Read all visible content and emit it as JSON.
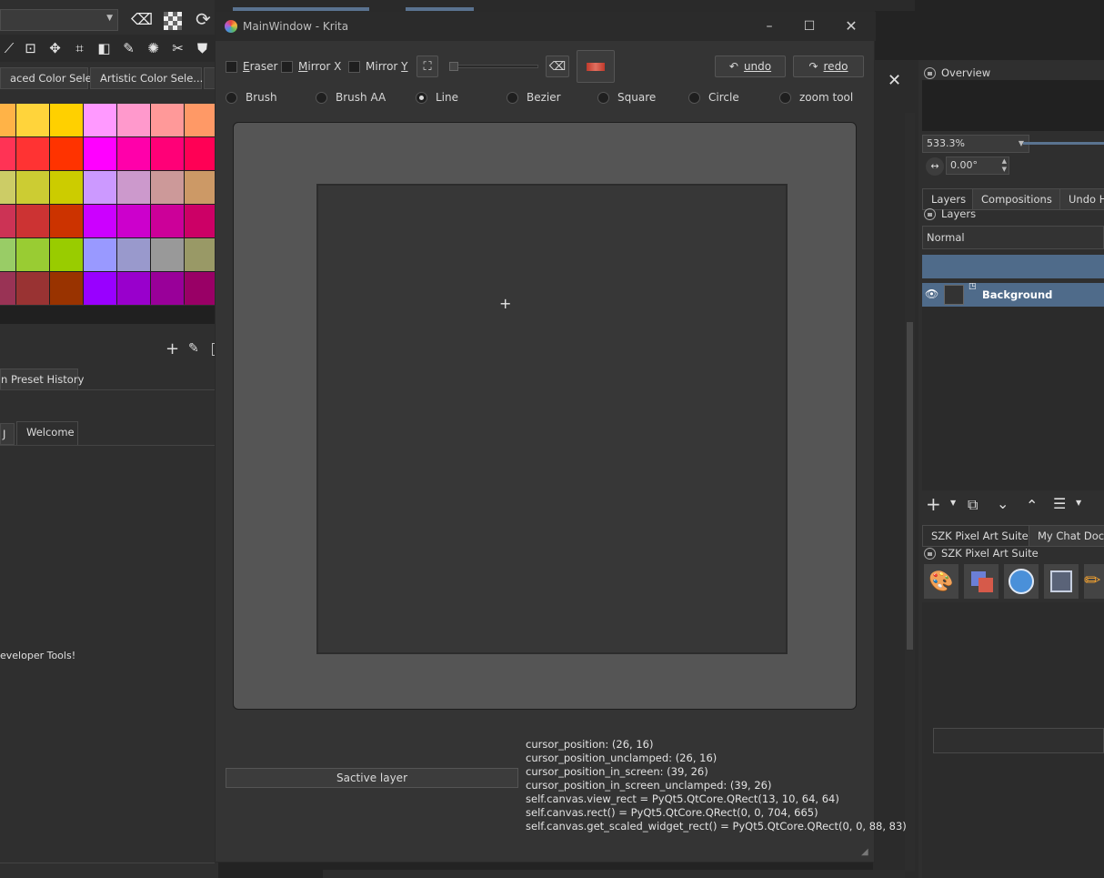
{
  "background_left": {
    "tool_icons": [
      "transform-icon",
      "move-icon",
      "crop-icon",
      "gradient-icon",
      "eyedropper-icon",
      "smart-patch-icon",
      "measure-icon",
      "fill-icon"
    ],
    "docker_tabs": [
      "aced Color Sele...",
      "Artistic Color Sele..."
    ],
    "palette_colors": [
      [
        "#ffb347",
        "#ffd43b",
        "#ffd000",
        "#ff99ff",
        "#ff99cc",
        "#ff9999",
        "#ff9966"
      ],
      [
        "#ff3355",
        "#ff3333",
        "#ff3300",
        "#ff00ff",
        "#ff00aa",
        "#ff0077",
        "#ff0055"
      ],
      [
        "#cccc66",
        "#cccc33",
        "#cccc00",
        "#cc99ff",
        "#cc99cc",
        "#cc9999",
        "#cc9966"
      ],
      [
        "#cc3355",
        "#cc3333",
        "#cc3300",
        "#cc00ff",
        "#cc00cc",
        "#cc0099",
        "#cc0066"
      ],
      [
        "#99cc66",
        "#99cc33",
        "#99cc00",
        "#9999ff",
        "#9999cc",
        "#999999",
        "#999966"
      ],
      [
        "#993355",
        "#993333",
        "#993300",
        "#9900ff",
        "#9900cc",
        "#990099",
        "#990066"
      ]
    ],
    "preset_tab": "n Preset History",
    "welcome_tab_left": "J",
    "welcome_tab": "Welcome",
    "developer_text": "eveloper Tools!"
  },
  "window": {
    "title": "MainWindow - Krita",
    "checkboxes": [
      {
        "label": "Eraser",
        "u": "E",
        "rest": "raser"
      },
      {
        "label": "Mirror X",
        "u": "M",
        "rest": "irror X"
      },
      {
        "label": "Mirror Y",
        "pre": "Mirror ",
        "u": "Y"
      }
    ],
    "undo_label": "undo",
    "redo_label": "redo",
    "tools": [
      {
        "label": "Brush",
        "checked": false
      },
      {
        "label": "Brush AA",
        "checked": false
      },
      {
        "label": "Line",
        "checked": true
      },
      {
        "label": "Bezier",
        "checked": false
      },
      {
        "label": "Square",
        "checked": false
      },
      {
        "label": "Circle",
        "checked": false
      },
      {
        "label": "zoom tool",
        "checked": false
      }
    ],
    "active_layer_button": "Sactive layer",
    "debug_lines": [
      " cursor_position: (26, 16)",
      " cursor_position_unclamped: (26, 16)",
      " cursor_position_in_screen: (39, 26)",
      " cursor_position_in_screen_unclamped: (39, 26)",
      "self.canvas.view_rect = PyQt5.QtCore.QRect(13, 10, 64, 64)",
      "self.canvas.rect() = PyQt5.QtCore.QRect(0, 0, 704, 665)",
      "self.canvas.get_scaled_widget_rect() = PyQt5.QtCore.QRect(0, 0, 88, 83)"
    ]
  },
  "right_dockers": {
    "overview_title": "Overview",
    "zoom_value": "533.3%",
    "rotation_value": "0.00°",
    "tabs": [
      "Layers",
      "Compositions",
      "Undo H"
    ],
    "layers_title": "Layers",
    "blend_mode": "Normal",
    "layer_name": "Background",
    "plugin_tabs": [
      "SZK Pixel Art Suite",
      "My Chat Docke"
    ],
    "plugin_title": "SZK Pixel Art Suite"
  }
}
